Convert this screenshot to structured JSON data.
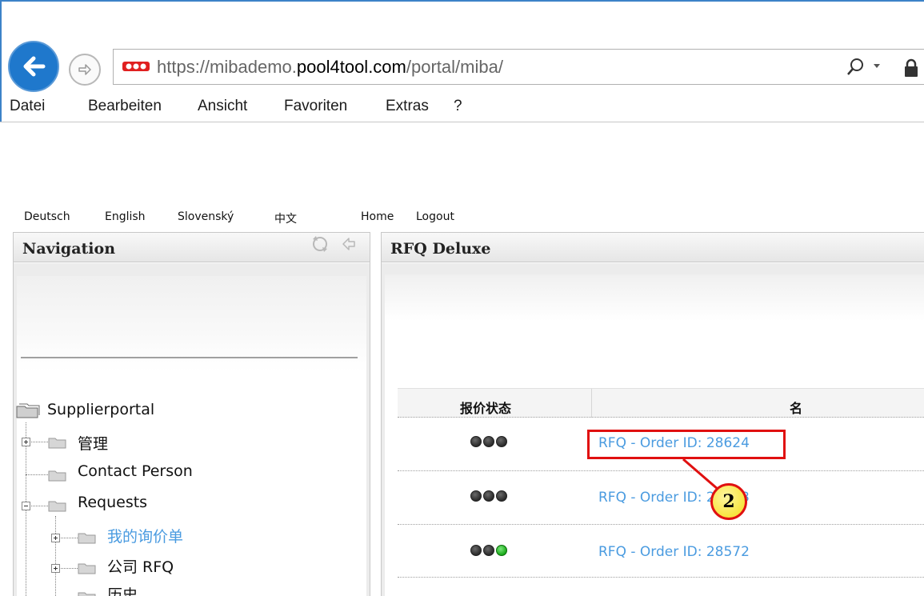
{
  "browser": {
    "url_scheme": "https://",
    "url_sub": "mibademo.",
    "url_host": "pool4tool.com",
    "url_path": "/portal/miba/",
    "menu": [
      "Datei",
      "Bearbeiten",
      "Ansicht",
      "Favoriten",
      "Extras",
      "?"
    ]
  },
  "toplinks": [
    "Deutsch",
    "English",
    "Slovenský",
    "中文",
    "Home",
    "Logout"
  ],
  "nav": {
    "title": "Navigation",
    "tree": {
      "root": "Supplierportal",
      "item_manage": "管理",
      "item_contact": "Contact Person",
      "item_requests": "Requests",
      "item_my_rfq": "我的询价单",
      "item_company_rfq": "公司 RFQ",
      "item_history": "历史"
    }
  },
  "main": {
    "title": "RFQ Deluxe",
    "columns": [
      "报价状态",
      "名"
    ],
    "rows": [
      {
        "name": "RFQ - Order ID: 28624",
        "status": [
          "off",
          "off",
          "off"
        ]
      },
      {
        "name": "RFQ - Order ID: 28623",
        "status": [
          "off",
          "off",
          "off"
        ]
      },
      {
        "name": "RFQ - Order ID: 28572",
        "status": [
          "off",
          "off",
          "green"
        ]
      }
    ]
  },
  "annotation": {
    "callout_number": "2"
  },
  "colors": {
    "accent_blue": "#1f78cc",
    "link_blue": "#4a9be0",
    "highlight_red": "#e01010",
    "callout_yellow": "#f8e440",
    "status_green": "#18a818"
  }
}
